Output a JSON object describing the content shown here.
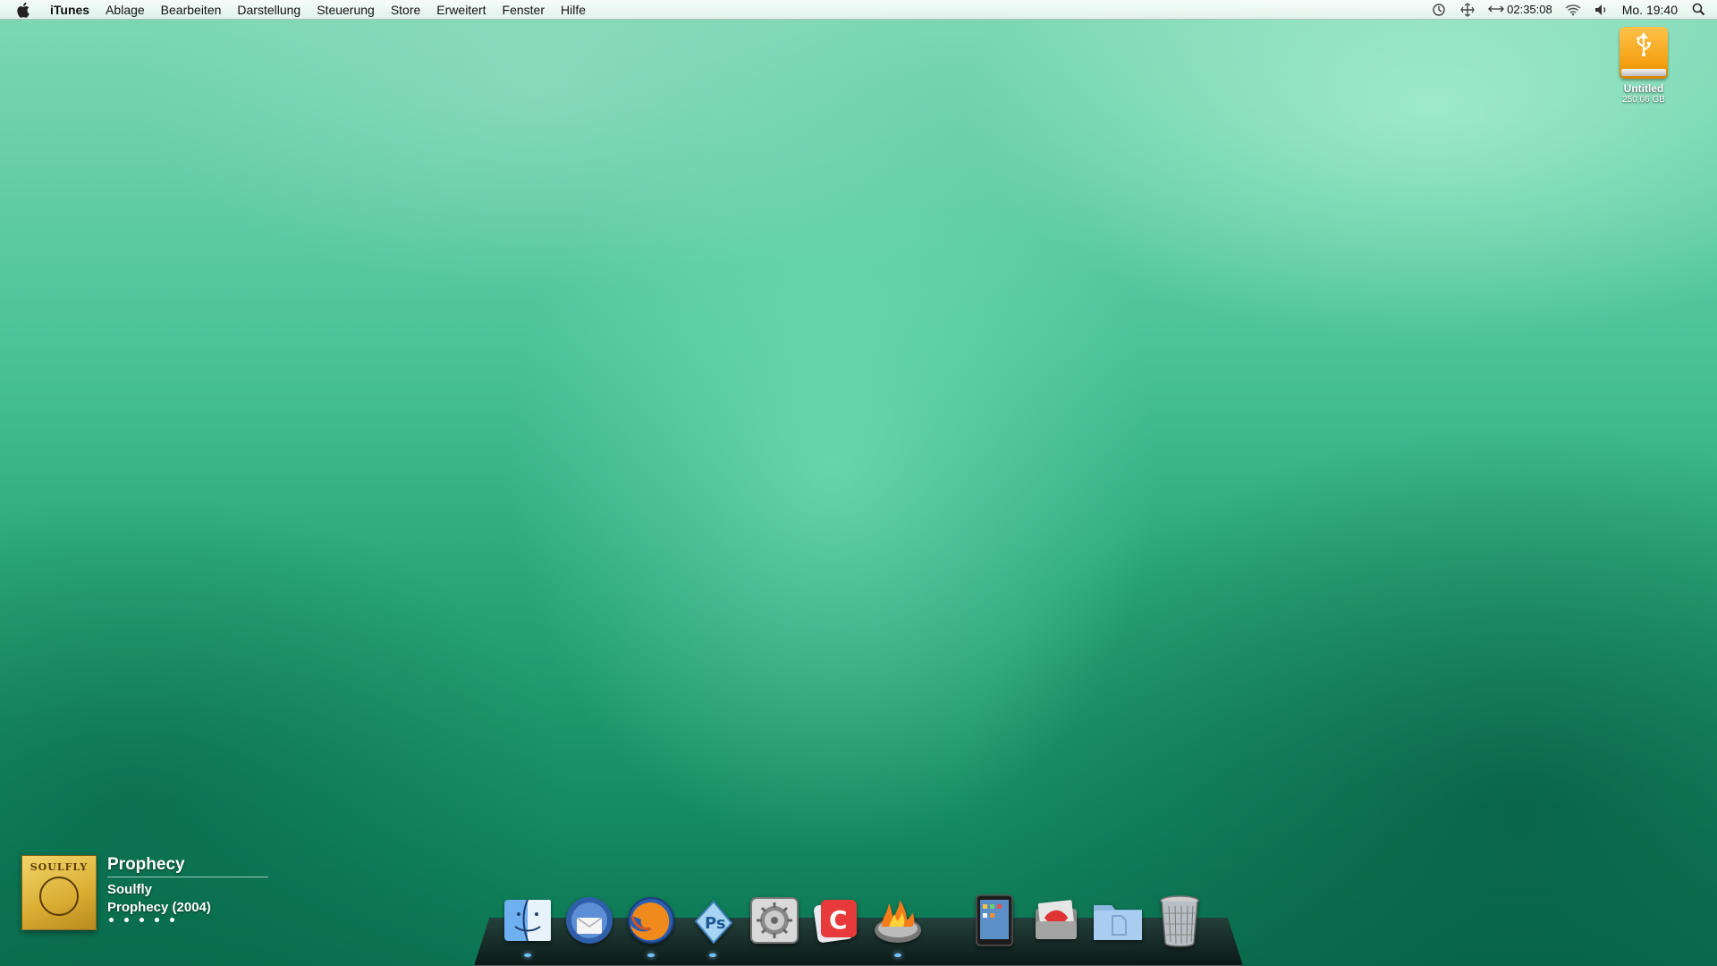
{
  "menubar": {
    "app_name": "iTunes",
    "items": [
      "Ablage",
      "Bearbeiten",
      "Darstellung",
      "Steuerung",
      "Store",
      "Erweitert",
      "Fenster",
      "Hilfe"
    ],
    "status": {
      "timer": "02:35:08",
      "clock": "Mo. 19:40"
    },
    "icons": [
      "apple-icon",
      "time-machine-icon",
      "network-activity-icon",
      "timer-icon",
      "wifi-icon",
      "volume-icon",
      "spotlight-icon"
    ]
  },
  "desktop": {
    "drive": {
      "name": "Untitled",
      "size": "250,06 GB",
      "icon": "usb-drive-icon"
    }
  },
  "now_playing": {
    "title": "Prophecy",
    "artist": "Soulfly",
    "album": "Prophecy (2004)",
    "cover_text": "SOULFLY",
    "rating_dots": 5
  },
  "dock": {
    "apps": [
      {
        "name": "Finder",
        "icon": "finder-icon",
        "running": true
      },
      {
        "name": "Thunderbird",
        "icon": "thunderbird-icon",
        "running": false
      },
      {
        "name": "Firefox",
        "icon": "firefox-icon",
        "running": true
      },
      {
        "name": "Photoshop",
        "icon": "photoshop-icon",
        "running": true
      },
      {
        "name": "Systemeinstellungen",
        "icon": "system-preferences-icon",
        "running": false
      },
      {
        "name": "Cyberduck",
        "icon": "app-c-icon",
        "running": false
      },
      {
        "name": "Burn",
        "icon": "burn-icon",
        "running": true
      }
    ],
    "stacks": [
      {
        "name": "iPad",
        "icon": "ipad-icon"
      },
      {
        "name": "Downloads",
        "icon": "downloads-stack-icon"
      },
      {
        "name": "Dokumente",
        "icon": "documents-folder-icon"
      },
      {
        "name": "Papierkorb",
        "icon": "trash-icon"
      }
    ]
  },
  "colors": {
    "wallpaper_light": "#7fd8b6",
    "wallpaper_dark": "#0c7452",
    "drive_orange": "#f4a012"
  }
}
